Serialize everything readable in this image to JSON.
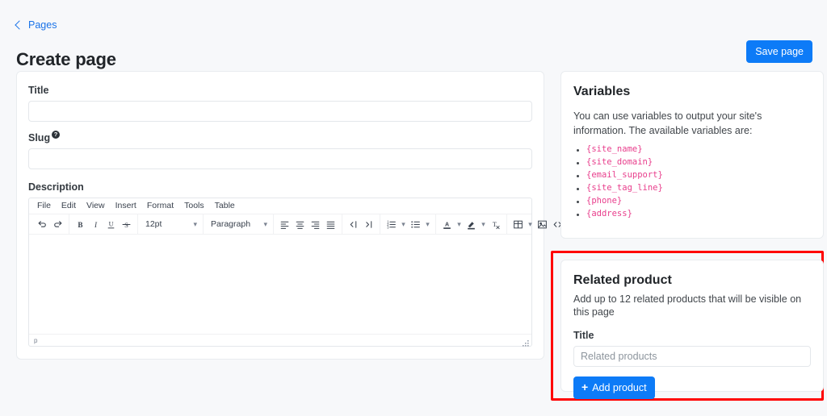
{
  "header": {
    "breadcrumb_label": "Pages",
    "back_icon": "chevron-left-icon",
    "title": "Create page",
    "save_label": "Save page"
  },
  "form": {
    "title_label": "Title",
    "title_value": "",
    "title_placeholder": "",
    "slug_label": "Slug",
    "slug_help_glyph": "?",
    "slug_value": "",
    "slug_placeholder": "",
    "description_label": "Description"
  },
  "editor": {
    "menubar": [
      {
        "label": "File"
      },
      {
        "label": "Edit"
      },
      {
        "label": "View"
      },
      {
        "label": "Insert"
      },
      {
        "label": "Format"
      },
      {
        "label": "Tools"
      },
      {
        "label": "Table"
      }
    ],
    "font_size_value": "12pt",
    "block_format_value": "Paragraph",
    "toolbar_icons": [
      "undo-icon",
      "redo-icon",
      "bold-icon",
      "italic-icon",
      "underline-icon",
      "strikethrough-icon",
      "align-left-icon",
      "align-center-icon",
      "align-right-icon",
      "align-justify-icon",
      "outdent-icon",
      "indent-icon",
      "numbered-list-icon",
      "bullet-list-icon",
      "text-color-icon",
      "background-color-icon",
      "clear-formatting-icon",
      "table-icon",
      "insert-image-icon",
      "source-code-icon",
      "insert-link-icon"
    ],
    "content": "",
    "status_path": "p",
    "resize_handle": "resize-grip-icon"
  },
  "variables": {
    "title": "Variables",
    "description": "You can use variables to output your site's information. The available variables are:",
    "items": [
      "{site_name}",
      "{site_domain}",
      "{email_support}",
      "{site_tag_line}",
      "{phone}",
      "{address}"
    ],
    "token_color": "#e83e8c"
  },
  "related_product": {
    "title": "Related product",
    "description": "Add up to 12 related products that will be visible on this page",
    "title_label": "Title",
    "title_value": "",
    "title_placeholder": "Related products",
    "add_button_label": "Add product",
    "add_button_icon": "plus-icon",
    "highlight_color": "#ff0000"
  },
  "theme": {
    "accent": "#0d7bf7",
    "link": "#1a73e8",
    "page_background": "#f7f8fa",
    "card_background": "#ffffff",
    "border": "#e9ecef"
  }
}
